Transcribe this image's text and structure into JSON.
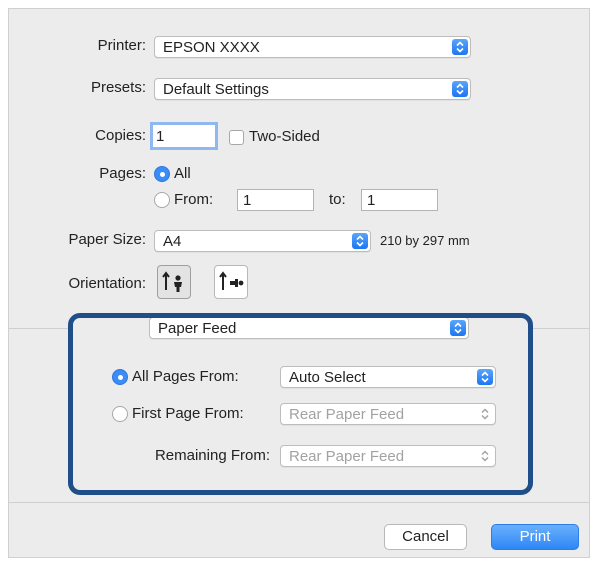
{
  "printer": {
    "label": "Printer:",
    "value": "EPSON XXXX"
  },
  "presets": {
    "label": "Presets:",
    "value": "Default Settings"
  },
  "copies": {
    "label": "Copies:",
    "value": "1",
    "two_sided_label": "Two-Sided"
  },
  "pages": {
    "label": "Pages:",
    "all_label": "All",
    "from_label": "From:",
    "from_value": "1",
    "to_label": "to:",
    "to_value": "1"
  },
  "paper_size": {
    "label": "Paper Size:",
    "value": "A4",
    "dimensions": "210 by 297 mm"
  },
  "orientation": {
    "label": "Orientation:"
  },
  "section": {
    "value": "Paper Feed"
  },
  "paper_feed": {
    "all_pages_label": "All Pages From:",
    "all_pages_value": "Auto Select",
    "first_page_label": "First Page From:",
    "first_page_value": "Rear Paper Feed",
    "remaining_label": "Remaining From:",
    "remaining_value": "Rear Paper Feed"
  },
  "buttons": {
    "cancel": "Cancel",
    "print": "Print"
  },
  "colors": {
    "accent": "#2e86f6",
    "highlight": "#1f4e88"
  },
  "icons": [
    "chevron-updown-icon",
    "portrait-icon",
    "landscape-icon"
  ]
}
